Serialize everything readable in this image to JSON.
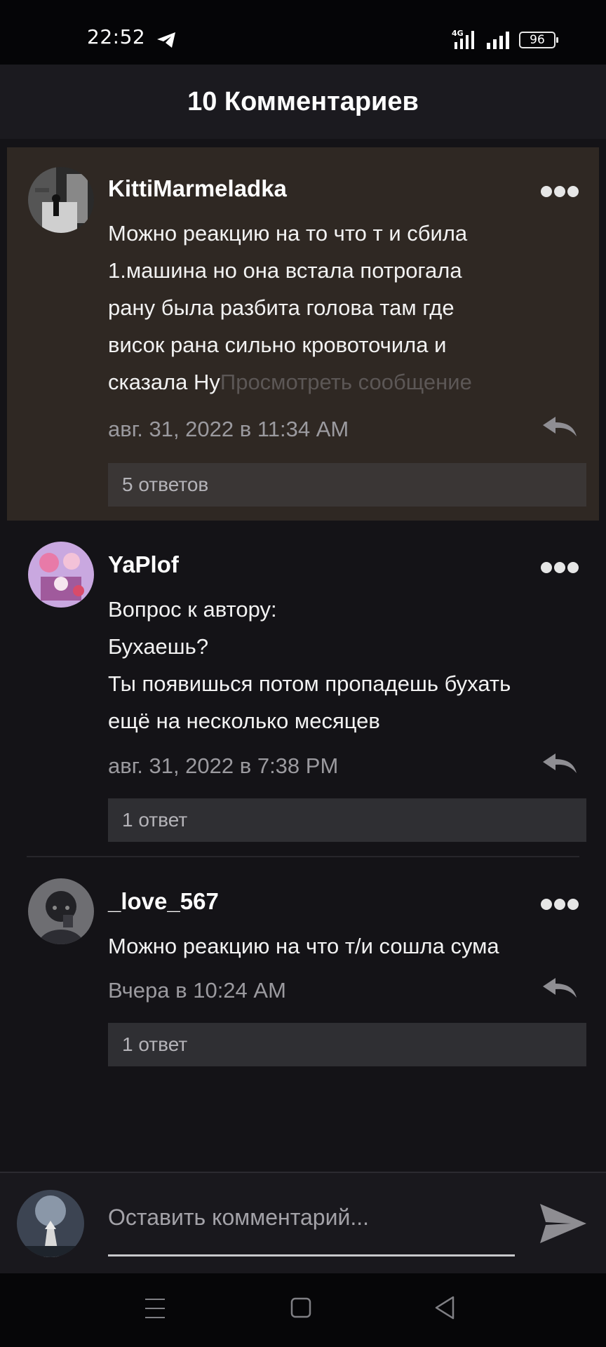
{
  "status_bar": {
    "time": "22:52",
    "network": "4G",
    "battery": "96"
  },
  "header": {
    "title": "10 Комментариев"
  },
  "comments": [
    {
      "username": "KittiMarmeladka",
      "lines": [
        "Можно реакцию на то что т и сбила",
        "1.машина но она встала потрогала",
        "рану была разбита голова там где",
        "висок рана сильно кровоточила и"
      ],
      "last_line": "сказала Ну",
      "view_message": "Просмотреть сообщение",
      "timestamp": "авг. 31, 2022 в 11:34 AM",
      "replies": "5 ответов",
      "highlighted": true
    },
    {
      "username": "YaPlof",
      "lines": [
        "Вопрос к автору:",
        "Бухаешь?",
        "Ты появишься потом пропадешь бухать",
        "ещё на несколько месяцев"
      ],
      "timestamp": "авг. 31, 2022 в 7:38 PM",
      "replies": "1 ответ"
    },
    {
      "username": "_love_567",
      "lines": [
        "Можно реакцию на что т/и сошла сума"
      ],
      "timestamp": "Вчера в 10:24 AM",
      "replies": "1 ответ"
    }
  ],
  "input": {
    "placeholder": "Оставить комментарий..."
  },
  "colors": {
    "background": "#141317",
    "highlight": "#2f2823",
    "reply_button": "#2f2f33",
    "muted_text": "#9b9a9f"
  },
  "icons": [
    "telegram-icon",
    "signal-icon",
    "battery-icon",
    "more-icon",
    "reply-icon",
    "send-icon",
    "menu-icon",
    "home-icon",
    "back-icon"
  ]
}
